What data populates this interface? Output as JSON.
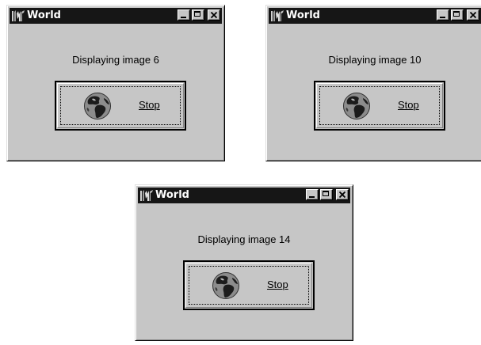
{
  "windows": [
    {
      "title": "World",
      "status": "Displaying image 6",
      "button_label": "Stop",
      "titlebar_icon": "app-logo-icon",
      "button_icon": "globe-icon"
    },
    {
      "title": "World",
      "status": "Displaying image 10",
      "button_label": "Stop",
      "titlebar_icon": "app-logo-icon",
      "button_icon": "globe-icon"
    },
    {
      "title": "World",
      "status": "Displaying image 14",
      "button_label": "Stop",
      "titlebar_icon": "app-logo-icon",
      "button_icon": "globe-icon"
    }
  ],
  "titlebar_buttons": [
    "minimize",
    "maximize",
    "close"
  ],
  "colors": {
    "window_face": "#c6c6c6",
    "titlebar": "#161616",
    "title_text": "#ffffff",
    "text": "#000000",
    "globe_land": "#1c1c1c",
    "globe_sea": "#8c8c8c"
  }
}
